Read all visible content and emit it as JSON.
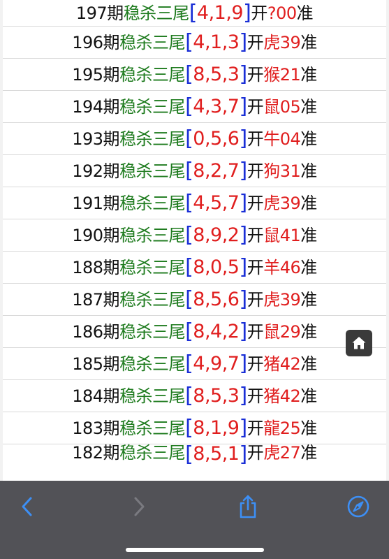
{
  "rows": [
    {
      "period": "197期",
      "label": "稳杀三尾",
      "lb": "[",
      "nums": "4,1,9",
      "rb": "]",
      "open": "开",
      "animal": "?",
      "num": "00",
      "suffix": "准"
    },
    {
      "period": "196期",
      "label": "稳杀三尾",
      "lb": "[",
      "nums": "4,1,3",
      "rb": "]",
      "open": "开",
      "animal": "虎",
      "num": "39",
      "suffix": "准"
    },
    {
      "period": "195期",
      "label": "稳杀三尾",
      "lb": "[",
      "nums": "8,5,3",
      "rb": "]",
      "open": "开",
      "animal": "猴",
      "num": "21",
      "suffix": "准"
    },
    {
      "period": "194期",
      "label": "稳杀三尾",
      "lb": "[",
      "nums": "4,3,7",
      "rb": "]",
      "open": "开",
      "animal": "鼠",
      "num": "05",
      "suffix": "准"
    },
    {
      "period": "193期",
      "label": "稳杀三尾",
      "lb": "[",
      "nums": "0,5,6",
      "rb": "]",
      "open": "开",
      "animal": "牛",
      "num": "04",
      "suffix": "准"
    },
    {
      "period": "192期",
      "label": "稳杀三尾",
      "lb": "[",
      "nums": "8,2,7",
      "rb": "]",
      "open": "开",
      "animal": "狗",
      "num": "31",
      "suffix": "准"
    },
    {
      "period": "191期",
      "label": "稳杀三尾",
      "lb": "[",
      "nums": "4,5,7",
      "rb": "]",
      "open": "开",
      "animal": "虎",
      "num": "39",
      "suffix": "准"
    },
    {
      "period": "190期",
      "label": "稳杀三尾",
      "lb": "[",
      "nums": "8,9,2",
      "rb": "]",
      "open": "开",
      "animal": "鼠",
      "num": "41",
      "suffix": "准"
    },
    {
      "period": "188期",
      "label": "稳杀三尾",
      "lb": "[",
      "nums": "8,0,5",
      "rb": "]",
      "open": "开",
      "animal": "羊",
      "num": "46",
      "suffix": "准"
    },
    {
      "period": "187期",
      "label": "稳杀三尾",
      "lb": "[",
      "nums": "8,5,6",
      "rb": "]",
      "open": "开",
      "animal": "虎",
      "num": "39",
      "suffix": "准"
    },
    {
      "period": "186期",
      "label": "稳杀三尾",
      "lb": "[",
      "nums": "8,4,2",
      "rb": "]",
      "open": "开",
      "animal": "鼠",
      "num": "29",
      "suffix": "准"
    },
    {
      "period": "185期",
      "label": "稳杀三尾",
      "lb": "[",
      "nums": "4,9,7",
      "rb": "]",
      "open": "开",
      "animal": "猪",
      "num": "42",
      "suffix": "准"
    },
    {
      "period": "184期",
      "label": "稳杀三尾",
      "lb": "[",
      "nums": "8,5,3",
      "rb": "]",
      "open": "开",
      "animal": "猪",
      "num": "42",
      "suffix": "准"
    },
    {
      "period": "183期",
      "label": "稳杀三尾",
      "lb": "[",
      "nums": "8,1,9",
      "rb": "]",
      "open": "开",
      "animal": "龍",
      "num": "25",
      "suffix": "准"
    },
    {
      "period": "182期",
      "label": "稳杀三尾",
      "lb": "[",
      "nums": "8,5,1",
      "rb": "]",
      "open": "开",
      "animal": "虎",
      "num": "27",
      "suffix": "准"
    }
  ],
  "icons": {
    "home": "home-icon",
    "back": "chevron-left-icon",
    "forward": "chevron-right-icon",
    "share": "share-icon",
    "browser": "compass-icon"
  },
  "colors": {
    "green": "#1e7b1e",
    "blue": "#1a2fd6",
    "red": "#e01e1e",
    "toolbar": "#525257",
    "accent": "#3d8ff5"
  }
}
